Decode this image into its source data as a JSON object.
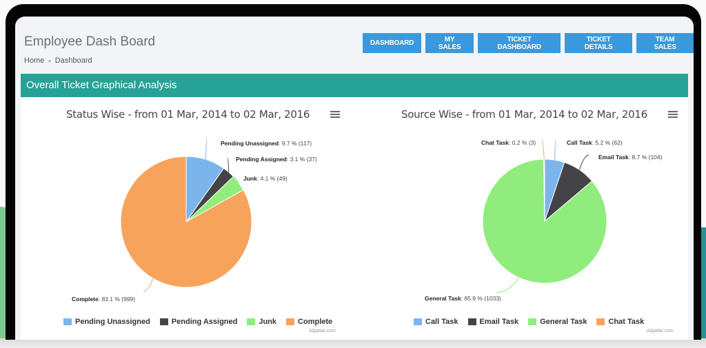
{
  "header": {
    "title": "Employee Dash Board",
    "breadcrumb": [
      "Home",
      "Dashboard"
    ]
  },
  "nav": {
    "buttons": [
      "DASHBOARD",
      "MY SALES",
      "TICKET DASHBOARD",
      "TICKET DETAILS",
      "TEAM SALES"
    ],
    "color": "#3a99dc"
  },
  "section": {
    "title": "Overall Ticket Graphical Analysis",
    "color": "#26a396"
  },
  "credit": "Adjattar.com",
  "chart_data": [
    {
      "type": "pie",
      "title": "Status Wise - from 01 Mar, 2014 to 02 Mar, 2016",
      "legend_position": "bottom",
      "slices": [
        {
          "name": "Pending Unassigned",
          "percent": 9.7,
          "count": 117,
          "color": "#7cb5ec"
        },
        {
          "name": "Pending Assigned",
          "percent": 3.1,
          "count": 37,
          "color": "#434348"
        },
        {
          "name": "Junk",
          "percent": 4.1,
          "count": 49,
          "color": "#90ed7d"
        },
        {
          "name": "Complete",
          "percent": 83.1,
          "count": 999,
          "color": "#f7a35c"
        }
      ]
    },
    {
      "type": "pie",
      "title": "Source Wise - from 01 Mar, 2014 to 02 Mar, 2016",
      "legend_position": "bottom",
      "slices": [
        {
          "name": "Call Task",
          "percent": 5.2,
          "count": 62,
          "color": "#7cb5ec"
        },
        {
          "name": "Email Task",
          "percent": 8.7,
          "count": 104,
          "color": "#434348"
        },
        {
          "name": "General Task",
          "percent": 85.9,
          "count": 1033,
          "color": "#90ed7d"
        },
        {
          "name": "Chat Task",
          "percent": 0.2,
          "count": 3,
          "color": "#f7a35c"
        }
      ]
    }
  ]
}
